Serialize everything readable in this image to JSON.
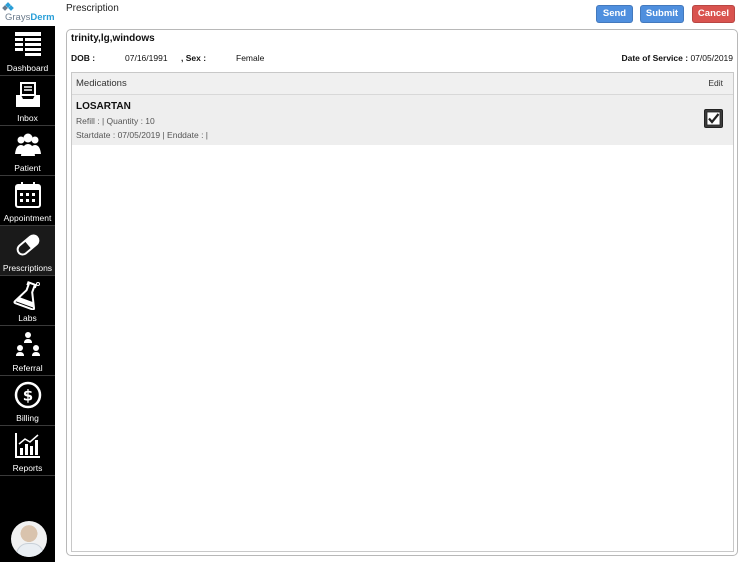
{
  "logo": {
    "part1": "Grays",
    "part2": "Derm"
  },
  "sidebar": {
    "items": [
      {
        "label": "Dashboard"
      },
      {
        "label": "Inbox"
      },
      {
        "label": "Patient"
      },
      {
        "label": "Appointment"
      },
      {
        "label": "Prescriptions"
      },
      {
        "label": "Labs"
      },
      {
        "label": "Referral"
      },
      {
        "label": "Billing"
      },
      {
        "label": "Reports"
      }
    ]
  },
  "header": {
    "title": "Prescription",
    "send_label": "Send",
    "submit_label": "Submit",
    "cancel_label": "Cancel"
  },
  "patient": {
    "name": "trinity,lg,windows",
    "dob_label": "DOB :",
    "dob": "07/16/1991",
    "sex_label": ", Sex :",
    "sex": "Female",
    "dos_label": "Date of Service :",
    "dos": "07/05/2019"
  },
  "medications": {
    "title": "Medications",
    "edit_label": "Edit",
    "items": [
      {
        "name": "LOSARTAN",
        "line1": "Refill :  | Quantity : 10",
        "line2": "Startdate : 07/05/2019 | Enddate :  |",
        "checked": true
      }
    ]
  },
  "colors": {
    "primary_button": "#4f8fde",
    "cancel_button": "#d9534f",
    "sidebar": "#000000",
    "logo_blue": "#2a9fd8"
  }
}
